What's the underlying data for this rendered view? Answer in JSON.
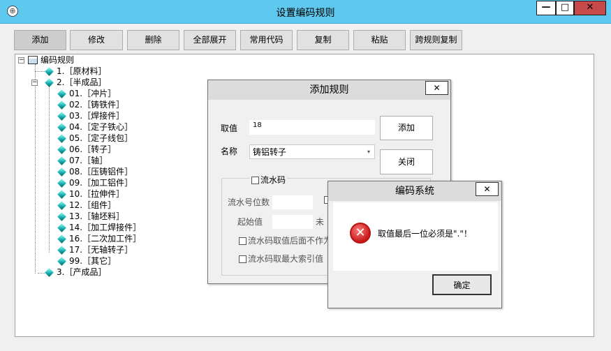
{
  "window": {
    "title": "设置编码规则",
    "controls": {
      "minimize": "—",
      "maximize": "□",
      "close": "✕"
    }
  },
  "toolbar": {
    "add": "添加",
    "edit": "修改",
    "delete": "删除",
    "expand_all": "全部展开",
    "common_code": "常用代码",
    "copy": "复制",
    "paste": "粘贴",
    "cross_rule_copy": "跨规则复制"
  },
  "tree": {
    "root": "编码规则",
    "items": [
      "1.［原材料］",
      "2.［半成品］",
      "01.［冲片］",
      "02.［铸铁件］",
      "03.［焊接件］",
      "04.［定子铁心］",
      "05.［定子线包］",
      "06.［转子］",
      "07.［轴］",
      "08.［压铸铝件］",
      "09.［加工铝件］",
      "10.［拉伸件］",
      "12.［组件］",
      "13.［轴坯料］",
      "14.［加工焊接件］",
      "16.［二次加工件］",
      "17.［无轴转子］",
      "99.［其它］",
      "3.［产成品］"
    ]
  },
  "add_rule_dialog": {
    "title": "添加规则",
    "close": "✕",
    "value_label": "取值",
    "value": "18",
    "name_label": "名称",
    "name_value": "铸铝转子",
    "add_button": "添加",
    "close_button": "关闭",
    "serial_checkbox": "流水码",
    "serial_digits_label": "流水号位数",
    "start_value_label": "起始值",
    "serial_no_suffix_label": "流水码取值后面不作为",
    "serial_max_index_label": "流水码取最大索引值"
  },
  "message_box": {
    "title": "编码系统",
    "close": "✕",
    "icon": "error-icon",
    "message": "取值最后一位必须是\".\"！",
    "ok_button": "确定"
  }
}
